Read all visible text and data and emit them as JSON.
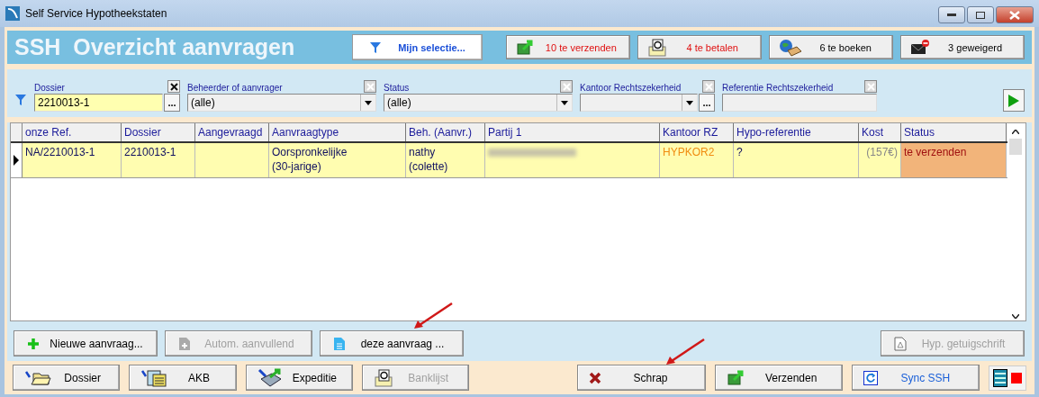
{
  "window": {
    "title": "Self Service Hypotheekstaten"
  },
  "header": {
    "title": "SSH  Overzicht aanvragen",
    "selection_button": "Mijn selectie...",
    "counters": [
      {
        "kind": "send",
        "label": "10 te verzenden",
        "alert": true
      },
      {
        "kind": "pay",
        "label": "4 te betalen",
        "alert": true
      },
      {
        "kind": "book",
        "label": "6 te boeken",
        "alert": false
      },
      {
        "kind": "refused",
        "label": "3 geweigerd",
        "alert": false
      }
    ]
  },
  "filters": [
    {
      "label": "Dossier",
      "kind": "text",
      "value": "2210013-1",
      "clear_enabled": true,
      "highlighted": true,
      "lookup_button": "..."
    },
    {
      "label": "Beheerder of aanvrager",
      "kind": "combo",
      "value": "(alle)",
      "clear_enabled": false,
      "highlighted": false
    },
    {
      "label": "Status",
      "kind": "combo",
      "value": "(alle)",
      "clear_enabled": false,
      "highlighted": false
    },
    {
      "label": "Kantoor Rechtszekerheid",
      "kind": "combo",
      "clear_enabled": false,
      "highlighted": false,
      "lookup_button": "..."
    },
    {
      "label": "Referentie Rechtszekerheid",
      "kind": "text",
      "clear_enabled": false,
      "highlighted": false
    }
  ],
  "table": {
    "columns": [
      "onze Ref.",
      "Dossier",
      "Aangevraagd",
      "Aanvraagtype",
      "Beh. (Aanvr.)",
      "Partij 1",
      "Kantoor RZ",
      "Hypo-referentie",
      "Kost",
      "Status"
    ],
    "rows": [
      {
        "current": true,
        "cells": [
          {
            "kind": "text",
            "text": "NA/2210013-1"
          },
          {
            "kind": "text",
            "text": "2210013-1"
          },
          {
            "kind": "empty"
          },
          {
            "kind": "text",
            "text": "Oorspronkelijke\n(30-jarige)"
          },
          {
            "kind": "text",
            "text": "nathy\n(colette)"
          },
          {
            "kind": "redacted"
          },
          {
            "kind": "code",
            "text": "HYPKOR2"
          },
          {
            "kind": "text",
            "text": "?"
          },
          {
            "kind": "cost",
            "text": "(157€)"
          },
          {
            "kind": "status",
            "text": "te verzenden"
          }
        ]
      }
    ]
  },
  "actions": [
    {
      "label": "Nieuwe aanvraag...",
      "disabled": false
    },
    {
      "label": "Autom. aanvullend",
      "disabled": true
    },
    {
      "label": "deze aanvraag ...",
      "disabled": false
    },
    {
      "label": "Hyp. getuigschrift",
      "disabled": true
    }
  ],
  "bottom_buttons": [
    {
      "label": "Dossier",
      "disabled": false,
      "link": false
    },
    {
      "label": "AKB",
      "disabled": false,
      "link": false
    },
    {
      "label": "Expeditie",
      "disabled": false,
      "link": false
    },
    {
      "label": "Banklijst",
      "disabled": true,
      "link": false
    },
    {
      "label": "Schrap",
      "disabled": false,
      "link": false
    },
    {
      "label": "Verzenden",
      "disabled": false,
      "link": false
    },
    {
      "label": "Sync SSH",
      "disabled": false,
      "link": true
    }
  ]
}
